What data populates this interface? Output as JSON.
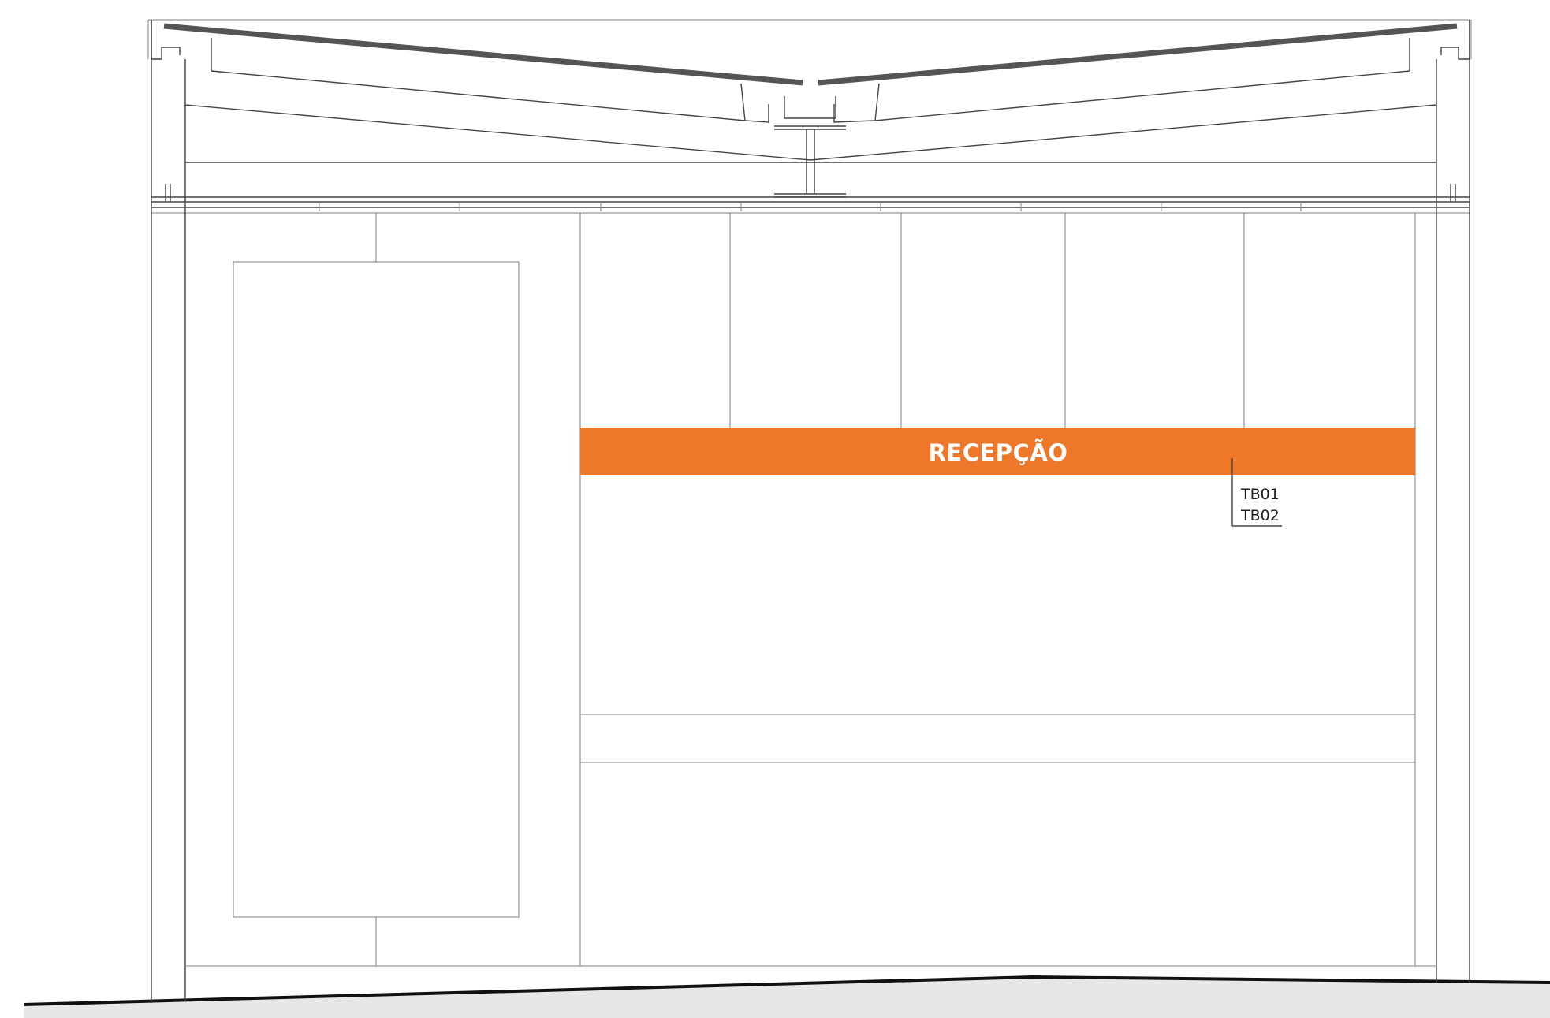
{
  "banner": {
    "label": "RECEPÇÃO",
    "color": "#ef7729"
  },
  "annotation": {
    "codes": [
      "TB01",
      "TB02"
    ]
  },
  "ground": {
    "color": "#e6e8e8"
  }
}
